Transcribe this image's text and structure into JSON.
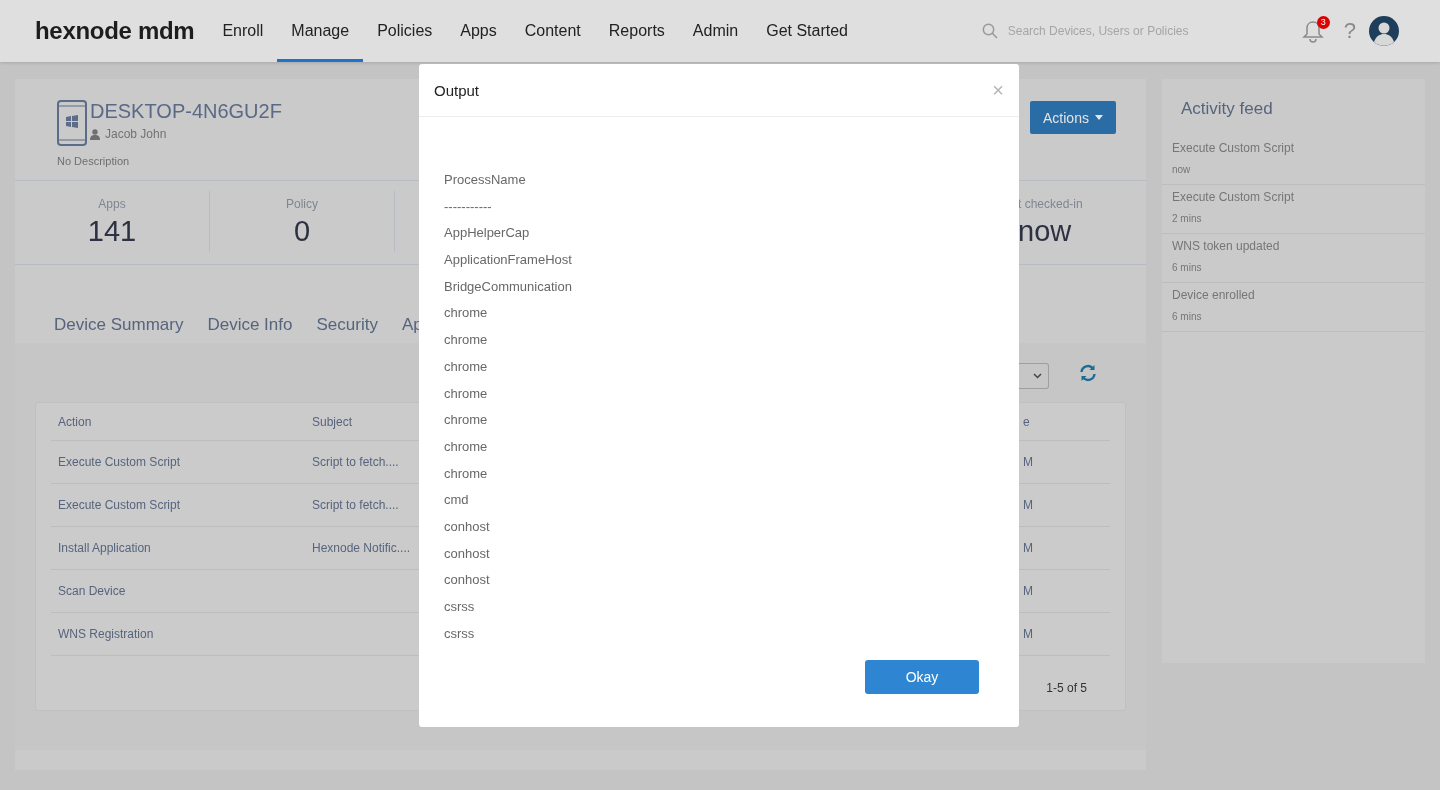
{
  "header": {
    "logo": "hexnode mdm",
    "nav": [
      {
        "label": "Enroll",
        "selected": false
      },
      {
        "label": "Manage",
        "selected": true
      },
      {
        "label": "Policies",
        "selected": false
      },
      {
        "label": "Apps",
        "selected": false
      },
      {
        "label": "Content",
        "selected": false
      },
      {
        "label": "Reports",
        "selected": false
      },
      {
        "label": "Admin",
        "selected": false
      },
      {
        "label": "Get Started",
        "selected": false
      }
    ],
    "search": {
      "placeholder": "Search Devices, Users or Policies"
    },
    "notification_count": "3",
    "help": "?"
  },
  "device": {
    "name": "DESKTOP-4N6GU2F",
    "user": "Jacob John",
    "description": "No Description",
    "actions_button": "Actions"
  },
  "stats": [
    {
      "label": "Apps",
      "value": "141"
    },
    {
      "label": "Policy",
      "value": "0"
    },
    {
      "label": "t checked-in",
      "value": "now"
    }
  ],
  "tabs": [
    {
      "label": "Device Summary"
    },
    {
      "label": "Device Info"
    },
    {
      "label": "Security"
    },
    {
      "label": "Ap"
    }
  ],
  "table": {
    "columns": [
      "Action",
      "Subject",
      "e"
    ],
    "rows": [
      {
        "action": "Execute Custom Script",
        "subject": "Script to fetch....",
        "column_3": "M"
      },
      {
        "action": "Execute Custom Script",
        "subject": "Script to fetch....",
        "column_3": "M"
      },
      {
        "action": "Install Application",
        "subject": "Hexnode Notific....",
        "column_3": "M"
      },
      {
        "action": "Scan Device",
        "column_3": "M"
      },
      {
        "action": "WNS Registration",
        "column_3": "M"
      }
    ],
    "pagination": "1-5 of 5"
  },
  "activity_feed": {
    "title": "Activity feed",
    "items": [
      {
        "title": "Execute Custom Script",
        "time": "now"
      },
      {
        "title": "Execute Custom Script",
        "time": "2 mins"
      },
      {
        "title": "WNS token updated",
        "time": "6 mins"
      },
      {
        "title": "Device enrolled",
        "time": "6 mins"
      }
    ]
  },
  "dialog": {
    "title": "Output",
    "close": "×",
    "lines": [
      "ProcessName",
      "-----------",
      "AppHelperCap",
      "ApplicationFrameHost",
      "BridgeCommunication",
      "chrome",
      "chrome",
      "chrome",
      "chrome",
      "chrome",
      "chrome",
      "chrome",
      "cmd",
      "conhost",
      "conhost",
      "conhost",
      "csrss",
      "csrss"
    ],
    "button": "Okay"
  }
}
